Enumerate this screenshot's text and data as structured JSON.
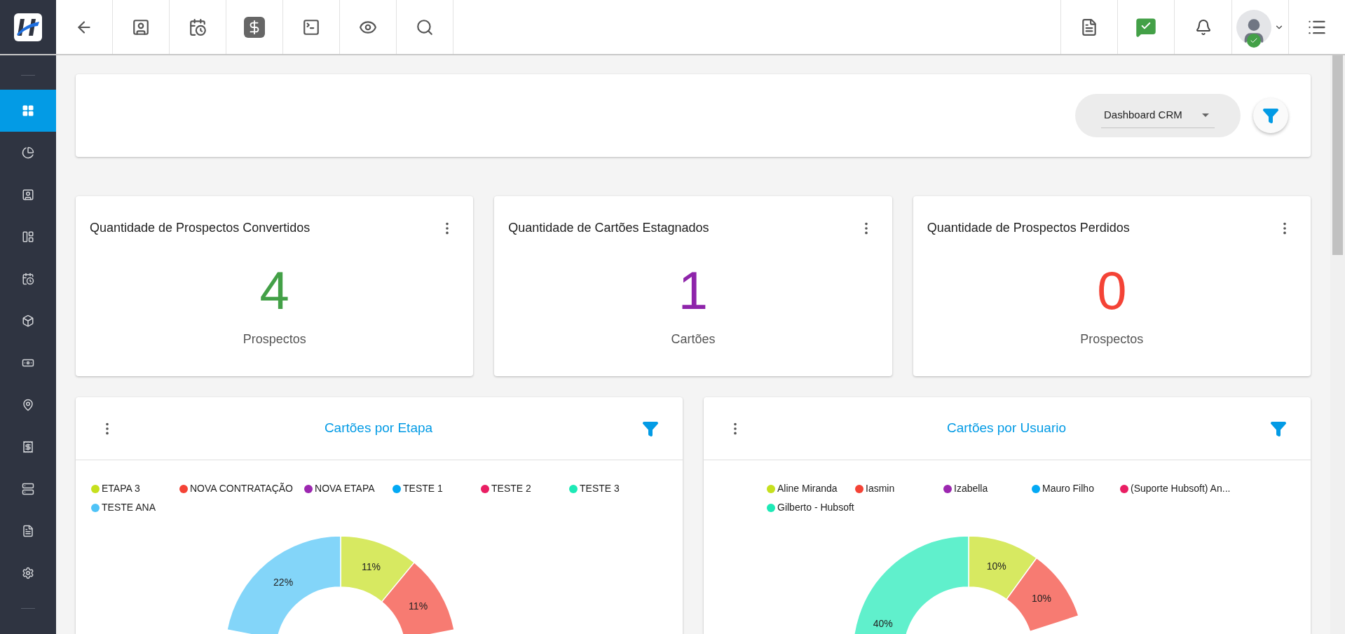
{
  "dashboard_select": {
    "value": "Dashboard CRM"
  },
  "kpis": [
    {
      "title": "Quantidade de Prospectos Convertidos",
      "value": "4",
      "unit": "Prospectos",
      "color": "#43a047"
    },
    {
      "title": "Quantidade de Cartões Estagnados",
      "value": "1",
      "unit": "Cartões",
      "color": "#8e24aa"
    },
    {
      "title": "Quantidade de Prospectos Perdidos",
      "value": "0",
      "unit": "Prospectos",
      "color": "#f44336"
    }
  ],
  "charts": [
    {
      "title": "Cartões por Etapa",
      "legend": [
        {
          "label": "ETAPA 3",
          "color": "#c6e01e"
        },
        {
          "label": "NOVA CONTRATAÇÃO",
          "color": "#f44336"
        },
        {
          "label": "NOVA ETAPA",
          "color": "#9c27b0"
        },
        {
          "label": "TESTE 1",
          "color": "#03a9f4"
        },
        {
          "label": "TESTE 2",
          "color": "#e91e63"
        },
        {
          "label": "TESTE 3",
          "color": "#1de9b6"
        },
        {
          "label": "TESTE ANA",
          "color": "#4fc3f7"
        }
      ],
      "chart_data": {
        "type": "donut",
        "values": [
          11,
          11,
          null,
          null,
          null,
          null,
          22
        ],
        "value_labels": [
          "11%",
          "11%",
          null,
          null,
          null,
          null,
          "22%"
        ]
      }
    },
    {
      "title": "Cartões por Usuario",
      "legend": [
        {
          "label": "Aline Miranda",
          "color": "#c6e01e"
        },
        {
          "label": "Iasmin",
          "color": "#f44336"
        },
        {
          "label": "Izabella",
          "color": "#9c27b0"
        },
        {
          "label": "Mauro Filho",
          "color": "#03a9f4"
        },
        {
          "label": "(Suporte Hubsoft) An...",
          "color": "#e91e63"
        },
        {
          "label": "Gilberto - Hubsoft",
          "color": "#1de9b6"
        }
      ],
      "chart_data": {
        "type": "donut",
        "values": [
          10,
          10,
          null,
          null,
          null,
          40
        ],
        "value_labels": [
          "10%",
          "10%",
          null,
          null,
          null,
          "40%"
        ]
      }
    }
  ]
}
